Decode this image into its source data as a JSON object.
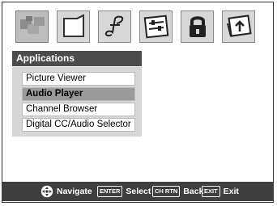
{
  "tabs": [
    {
      "icon": "apps-icon",
      "active": true
    },
    {
      "icon": "picture-icon",
      "active": false
    },
    {
      "icon": "music-note-icon",
      "active": false
    },
    {
      "icon": "setup-icon",
      "active": false
    },
    {
      "icon": "lock-icon",
      "active": false
    },
    {
      "icon": "install-icon",
      "active": false
    }
  ],
  "panel": {
    "title": "Applications",
    "items": [
      {
        "label": "Picture Viewer",
        "selected": false
      },
      {
        "label": "Audio Player",
        "selected": true
      },
      {
        "label": "Channel Browser",
        "selected": false
      },
      {
        "label": "Digital CC/Audio Selector",
        "selected": false
      }
    ]
  },
  "help_bar": {
    "navigate": {
      "icon": "navigate-dpad-icon",
      "label": "Navigate"
    },
    "select": {
      "key": "ENTER",
      "label": "Select"
    },
    "back": {
      "key": "CH RTN",
      "label": "Back"
    },
    "exit": {
      "key": "EXIT",
      "label": "Exit"
    }
  }
}
